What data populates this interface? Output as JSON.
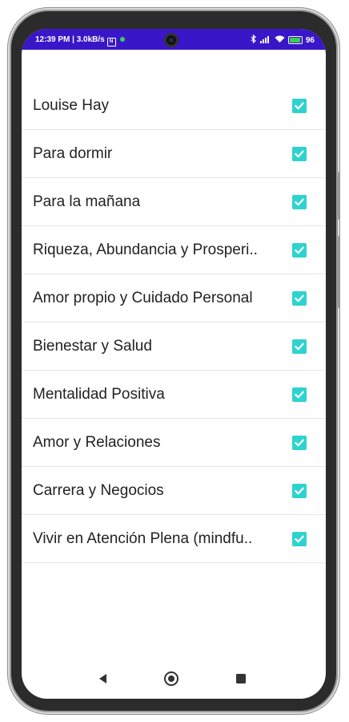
{
  "status_bar": {
    "time": "12:39 PM",
    "speed": "3.0kB/s",
    "battery": "96",
    "battery_level": 0.96,
    "icons": [
      "nfc-icon",
      "notification-dot-icon",
      "bluetooth-icon",
      "signal-icon",
      "wifi-icon",
      "battery-icon"
    ],
    "background_color": "#3a16c9"
  },
  "list": {
    "items": [
      {
        "label": "Louise Hay",
        "checked": true
      },
      {
        "label": "Para dormir",
        "checked": true
      },
      {
        "label": "Para la mañana",
        "checked": true
      },
      {
        "label": "Riqueza, Abundancia y Prosperi..",
        "checked": true
      },
      {
        "label": "Amor propio y Cuidado Personal",
        "checked": true
      },
      {
        "label": "Bienestar y Salud",
        "checked": true
      },
      {
        "label": "Mentalidad Positiva",
        "checked": true
      },
      {
        "label": "Amor y Relaciones",
        "checked": true
      },
      {
        "label": "Carrera y Negocios",
        "checked": true
      },
      {
        "label": "Vivir en Atención Plena (mindfu..",
        "checked": true
      }
    ],
    "checkbox_color": "#2ed3cf"
  },
  "nav_bar": {
    "icons": [
      "back-icon",
      "home-icon",
      "recents-icon"
    ]
  }
}
